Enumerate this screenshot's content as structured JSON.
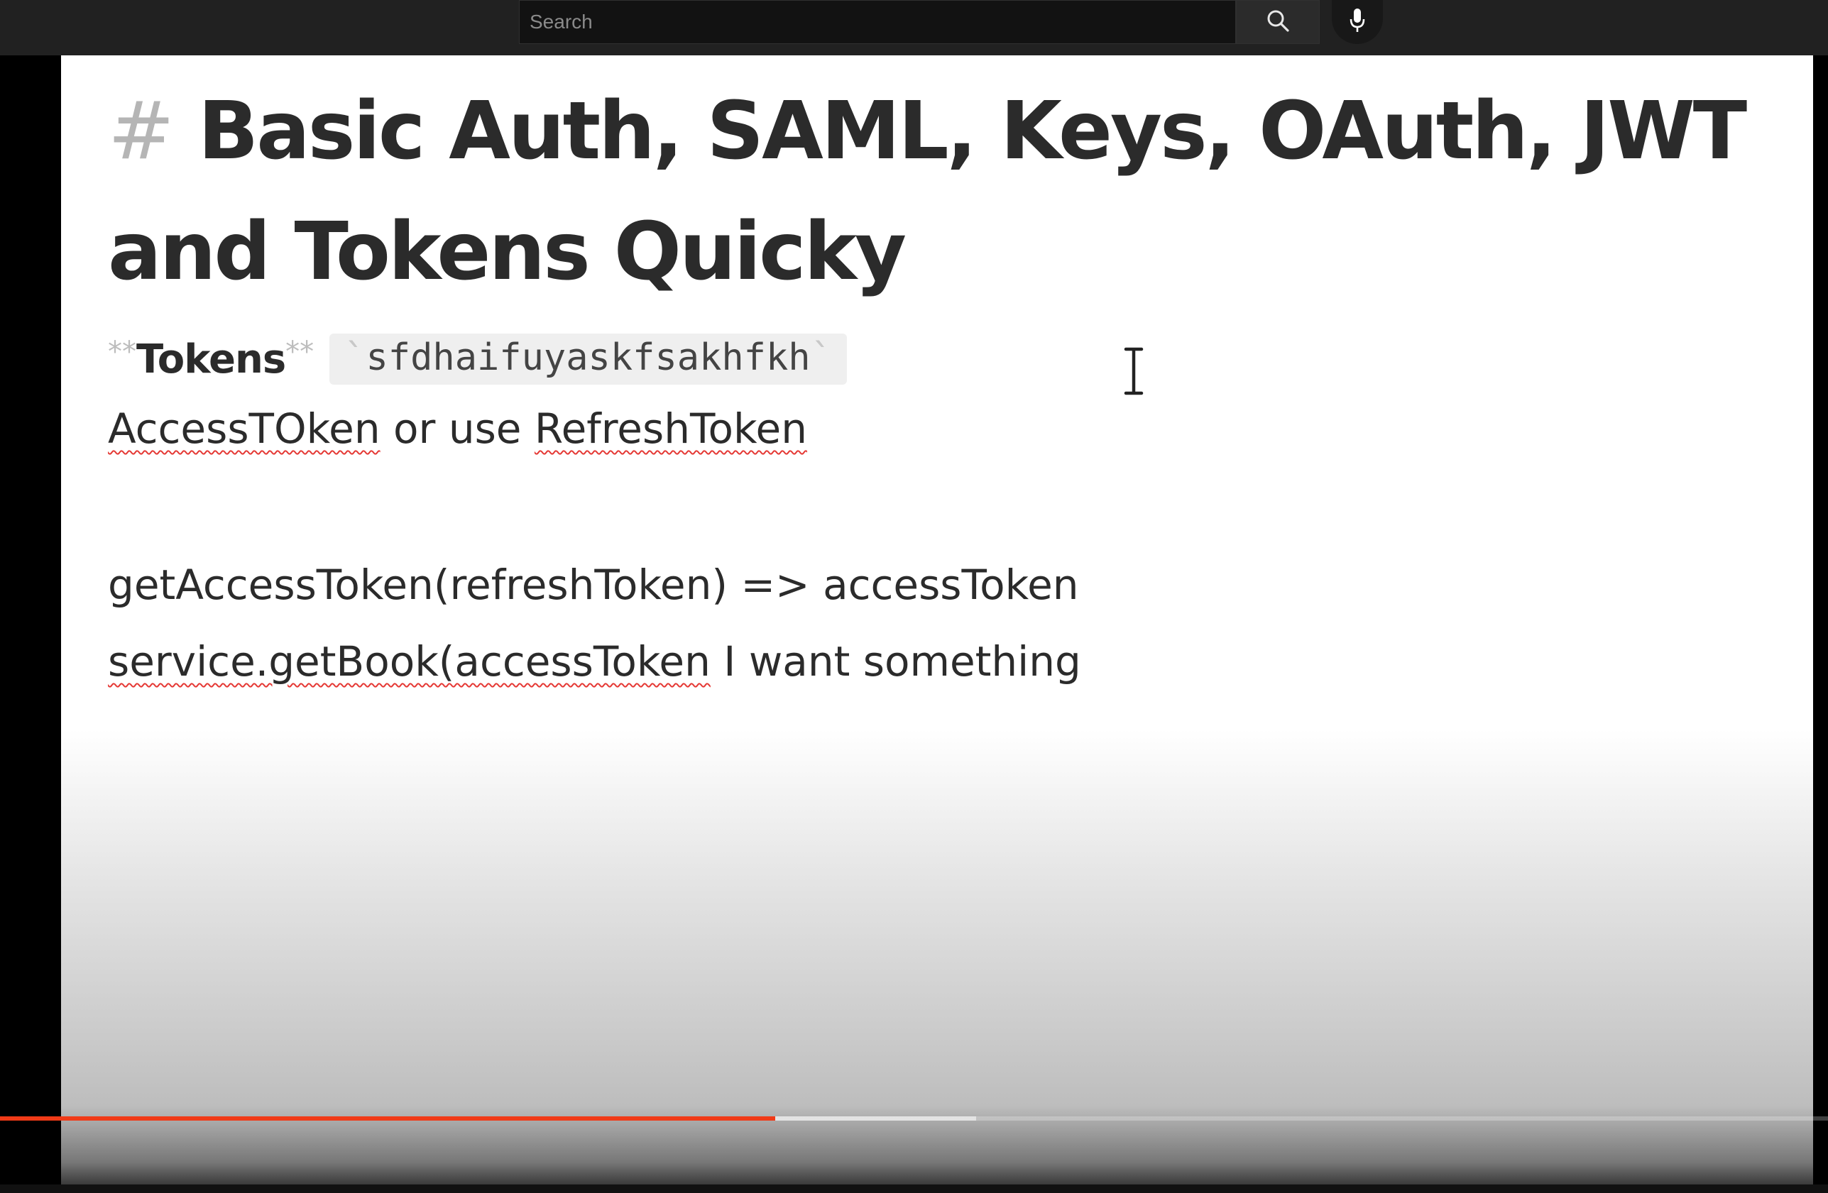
{
  "search": {
    "placeholder": "Search"
  },
  "icons": {
    "search": "search-icon",
    "mic": "microphone-icon",
    "cursor": "text-cursor-icon"
  },
  "document": {
    "title_hash": "#",
    "title_line_1": "Basic Auth, SAML, Keys, OAuth, JWT",
    "title_line_2": "and Tokens Quicky",
    "tokens_md_open": "**",
    "tokens_label": "Tokens",
    "tokens_md_close": "**",
    "code_tick_open": "`",
    "code_value": "sfdhaifuyaskfsakhfkh",
    "code_tick_close": "`",
    "access_word": "AccessTOken",
    "access_mid": " or use ",
    "refresh_word": "RefreshToken",
    "get_line": "getAccessToken(refreshToken) => accessToken",
    "service_word": "service.getBook(accessToken",
    "service_rest": " I want something"
  },
  "progress": {
    "played_fraction": 0.424,
    "buffered_fraction": 0.534
  },
  "colors": {
    "progress_played": "#f03a17",
    "spellcheck_underline": "#e53935",
    "text": "#2b2b2b",
    "topbar": "#212121"
  }
}
